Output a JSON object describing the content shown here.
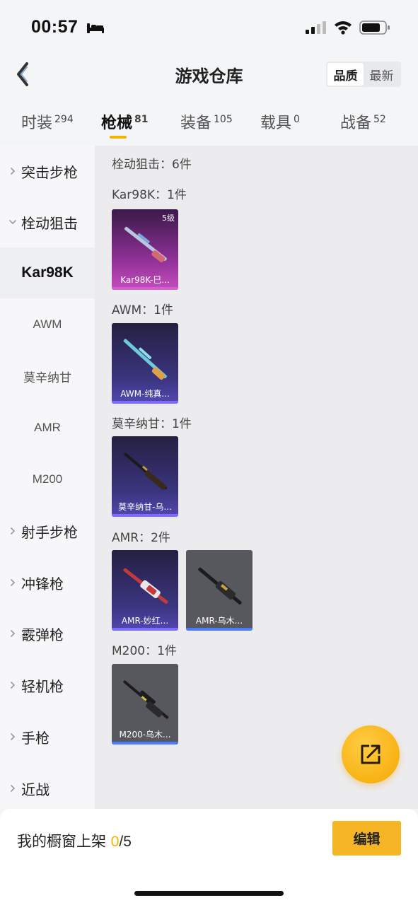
{
  "status_bar": {
    "time": "00:57"
  },
  "nav": {
    "title": "游戏仓库",
    "sort_options": [
      "品质",
      "最新"
    ],
    "active_sort": "品质"
  },
  "tabs": [
    {
      "label": "时装",
      "count": "294"
    },
    {
      "label": "枪械",
      "count": "81"
    },
    {
      "label": "装备",
      "count": "105"
    },
    {
      "label": "载具",
      "count": "0"
    },
    {
      "label": "战备",
      "count": "52"
    }
  ],
  "active_tab": "枪械",
  "sidebar": {
    "items": [
      {
        "label": "突击步枪",
        "type": "group",
        "expanded": false
      },
      {
        "label": "栓动狙击",
        "type": "group",
        "expanded": true
      },
      {
        "label": "Kar98K",
        "type": "sub",
        "selected": true
      },
      {
        "label": "AWM",
        "type": "sub"
      },
      {
        "label": "莫辛纳甘",
        "type": "sub"
      },
      {
        "label": "AMR",
        "type": "sub"
      },
      {
        "label": "M200",
        "type": "sub"
      },
      {
        "label": "射手步枪",
        "type": "group",
        "expanded": false
      },
      {
        "label": "冲锋枪",
        "type": "group",
        "expanded": false
      },
      {
        "label": "霰弹枪",
        "type": "group",
        "expanded": false
      },
      {
        "label": "轻机枪",
        "type": "group",
        "expanded": false
      },
      {
        "label": "手枪",
        "type": "group",
        "expanded": false
      },
      {
        "label": "近战",
        "type": "group",
        "expanded": false
      }
    ]
  },
  "content": {
    "category_summary": "栓动狙击：6件",
    "sections": [
      {
        "label": "Kar98K：1件",
        "items": [
          {
            "name": "Kar98K-巳...",
            "level": "5级",
            "rarity": "legendary",
            "bar_color": "#d65fd0"
          }
        ]
      },
      {
        "label": "AWM：1件",
        "items": [
          {
            "name": "AWM-纯真...",
            "rarity": "epic",
            "bar_color": "#7b6cff"
          }
        ]
      },
      {
        "label": "莫辛纳甘：1件",
        "items": [
          {
            "name": "莫辛纳甘-乌...",
            "rarity": "epic",
            "bar_color": "#7b6cff"
          }
        ]
      },
      {
        "label": "AMR：2件",
        "items": [
          {
            "name": "AMR-妙红...",
            "rarity": "epic",
            "bar_color": "#7b6cff"
          },
          {
            "name": "AMR-乌木...",
            "rarity": "normal",
            "bar_color": "#4d7bff"
          }
        ]
      },
      {
        "label": "M200：1件",
        "items": [
          {
            "name": "M200-乌木...",
            "rarity": "normal",
            "bar_color": "#4d7bff"
          }
        ]
      }
    ]
  },
  "bottom": {
    "shelf_label": "我的橱窗上架 ",
    "shelf_count": "0",
    "shelf_total": "/5",
    "edit_label": "编辑"
  },
  "colors": {
    "accent": "#f5b400",
    "legendary": "#b13fb0",
    "epic": "#3d3686",
    "normal": "#55555d"
  },
  "icons": [
    "bed-icon",
    "signal-icon",
    "wifi-icon",
    "battery-icon",
    "back-chevron-icon",
    "share-icon",
    "chevron-right-icon",
    "chevron-down-icon"
  ]
}
